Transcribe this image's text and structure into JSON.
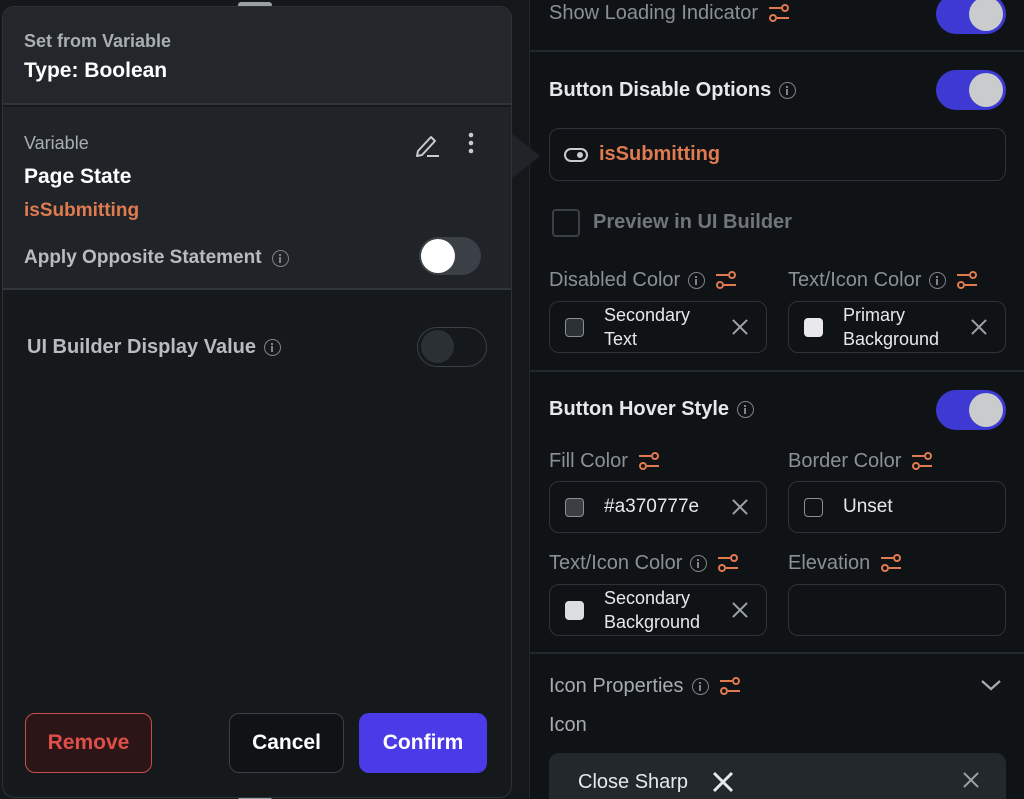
{
  "popover": {
    "subtitle": "Set from Variable",
    "title": "Type: Boolean",
    "variable_label": "Variable",
    "variable_source": "Page State",
    "variable_name": "isSubmitting",
    "apply_opposite_label": "Apply Opposite Statement",
    "apply_opposite_on": false,
    "ui_builder_label": "UI Builder Display Value",
    "ui_builder_on": false,
    "remove_label": "Remove",
    "cancel_label": "Cancel",
    "confirm_label": "Confirm"
  },
  "properties": {
    "loading_indicator_label": "Show Loading Indicator",
    "loading_indicator_on": true,
    "disable_options_label": "Button Disable Options",
    "disable_options_on": true,
    "disable_variable": "isSubmitting",
    "preview_label": "Preview in UI Builder",
    "preview_checked": false,
    "disabled_color_label": "Disabled Color",
    "disabled_color_value_line1": "Secondary",
    "disabled_color_value_line2": "Text",
    "disabled_text_color_label": "Text/Icon Color",
    "disabled_text_color_value_line1": "Primary",
    "disabled_text_color_value_line2": "Background",
    "hover_style_label": "Button Hover Style",
    "hover_style_on": true,
    "fill_color_label": "Fill Color",
    "fill_color_value": "#a370777e",
    "border_color_label": "Border Color",
    "border_color_value": "Unset",
    "hover_text_color_label": "Text/Icon Color",
    "hover_text_color_value_line1": "Secondary",
    "hover_text_color_value_line2": "Background",
    "elevation_label": "Elevation",
    "elevation_value": "",
    "icon_properties_label": "Icon Properties",
    "icon_label": "Icon",
    "icon_value": "Close Sharp"
  },
  "colors": {
    "accent": "#3d39d2",
    "variable_orange": "#e07a4f",
    "confirm": "#4b3ae8",
    "remove": "#de4f49",
    "swatch_secondary_text": "#2c3136",
    "swatch_primary_background": "#e9e9eb",
    "swatch_fill": "#3b3f44",
    "swatch_secondary_background": "#dcdde0"
  },
  "icons": [
    "info-icon",
    "sliders-icon",
    "toggle-variable-icon",
    "edit-pencil-icon",
    "more-vert-icon",
    "close-icon",
    "chevron-down-icon"
  ]
}
